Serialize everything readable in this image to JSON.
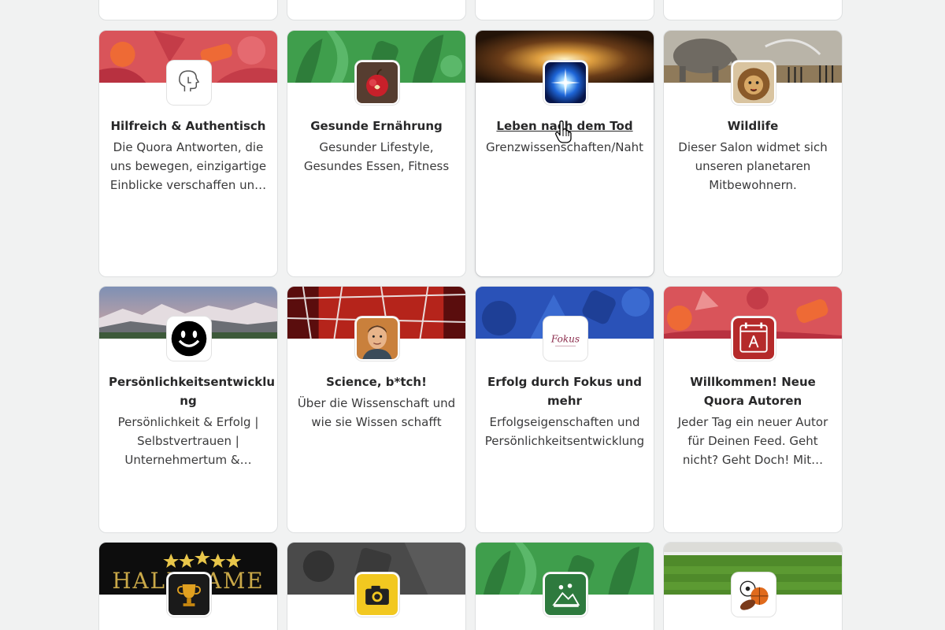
{
  "cards": [
    {
      "title": "",
      "description": ""
    },
    {
      "title": "",
      "description": ""
    },
    {
      "title": "",
      "description": ""
    },
    {
      "title": "",
      "description": ""
    },
    {
      "title": "Hilfreich & Authentisch",
      "description_lines": [
        "Die Quora Antworten, die",
        "uns bewegen, einzigartige",
        "Einblicke verschaffen un…"
      ],
      "avatar_icon": "head-profile-icon",
      "cover": "red-pattern"
    },
    {
      "title": "Gesunde Ernährung",
      "description_lines": [
        "Gesunder Lifestyle,",
        "Gesundes Essen, Fitness"
      ],
      "avatar_icon": "apple-icon",
      "cover": "green-leaves"
    },
    {
      "title": "Leben nach dem Tod",
      "description_lines": [
        "Grenzwissenschaften/Naht"
      ],
      "avatar_icon": "light-burst-icon",
      "cover": "tunnel-light"
    },
    {
      "title": "Wildlife",
      "description_lines": [
        "Dieser Salon widmet sich",
        "unseren planetaren",
        "Mitbewohnern."
      ],
      "avatar_icon": "lion-icon",
      "cover": "elephant-savanna"
    },
    {
      "title_lines": [
        "Persönlichkeitsentwicklu",
        "ng"
      ],
      "description_lines": [
        "Persönlichkeit & Erfolg |",
        "Selbstvertrauen |",
        "Unternehmertum &…"
      ],
      "avatar_icon": "smiley-icon",
      "cover": "mountain-landscape"
    },
    {
      "title": "Science, b*tch!",
      "description_lines": [
        "Über die Wissenschaft und",
        "wie sie Wissen schafft"
      ],
      "avatar_icon": "person-portrait-icon",
      "cover": "red-grid"
    },
    {
      "title_lines": [
        "Erfolg durch Fokus und",
        "mehr"
      ],
      "description_lines": [
        "Erfolgseigenschaften und",
        "Persönlichkeitsentwicklung"
      ],
      "avatar_icon": "fokus-logo-icon",
      "avatar_logo_text": "Fokus",
      "cover": "blue-pattern"
    },
    {
      "title_lines": [
        "Willkommen! Neue",
        "Quora Autoren"
      ],
      "description_lines": [
        "Jeder Tag ein neuer Autor",
        "für Deinen Feed. Geht",
        "nicht? Geht Doch! Mit…"
      ],
      "avatar_icon": "calendar-icon",
      "cover": "red-pattern"
    },
    {
      "title": "",
      "avatar_icon": "trophy-icon",
      "cover": "hall-of-fame",
      "cover_text": "HALL FAME"
    },
    {
      "title": "",
      "avatar_icon": "camera-icon",
      "cover": "gray-pattern"
    },
    {
      "title": "",
      "avatar_icon": "landscape-icon",
      "cover": "green-leaves"
    },
    {
      "title": "",
      "avatar_icon": "sports-balls-icon",
      "cover": "sports-field"
    }
  ],
  "colors": {
    "page_bg": "#f1f2f2",
    "card_border": "#dee0e1",
    "title_text": "#282829",
    "desc_text": "#3a3a3b"
  }
}
